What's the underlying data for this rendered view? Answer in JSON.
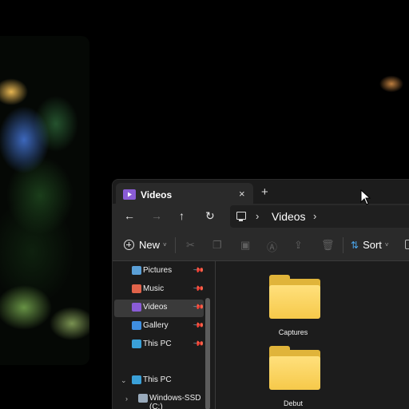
{
  "window": {
    "tab_title": "Videos",
    "tab_close_glyph": "×",
    "new_tab_glyph": "+"
  },
  "navigation": {
    "back_glyph": "←",
    "forward_glyph": "→",
    "up_glyph": "↑",
    "refresh_glyph": "↻",
    "breadcrumb": "Videos",
    "separator_glyph": "›"
  },
  "toolbar": {
    "new_label": "New",
    "sort_label": "Sort",
    "cut_glyph": "✂",
    "copy_glyph": "❐",
    "paste_glyph": "▣",
    "rename_glyph": "Ⓐ",
    "share_glyph": "⇪",
    "delete_glyph": "🗑",
    "sort_glyph": "⇅",
    "caret_glyph": "˅"
  },
  "sidebar": {
    "pin_glyph": "📌",
    "expand_open_glyph": "⌄",
    "expand_closed_glyph": "›",
    "items": [
      {
        "label": "Pictures",
        "icon": "pictures-icon",
        "color": "#5a9fd6",
        "pinned": true
      },
      {
        "label": "Music",
        "icon": "music-icon",
        "color": "#e0634a",
        "pinned": true
      },
      {
        "label": "Videos",
        "icon": "videos-icon",
        "color": "#8a5cd6",
        "pinned": true,
        "selected": true
      },
      {
        "label": "Gallery",
        "icon": "gallery-icon",
        "color": "#3f8ee0",
        "pinned": true
      },
      {
        "label": "This PC",
        "icon": "this-pc-icon",
        "color": "#3aa0d8",
        "pinned": true
      },
      {
        "label": "This PC",
        "icon": "this-pc-icon",
        "color": "#3aa0d8",
        "expanded": true
      },
      {
        "label": "Windows-SSD (C:)",
        "icon": "drive-icon",
        "color": "#9ab"
      }
    ]
  },
  "content": {
    "folders": [
      {
        "name": "Captures",
        "icon": "folder-icon"
      },
      {
        "name": "Debut",
        "icon": "folder-icon"
      }
    ]
  },
  "colors": {
    "accent": "#4aa3e8",
    "folder_yellow": "#f6c94a",
    "window_bg": "#1c1c1c",
    "bar_bg": "#2a2a2a"
  }
}
